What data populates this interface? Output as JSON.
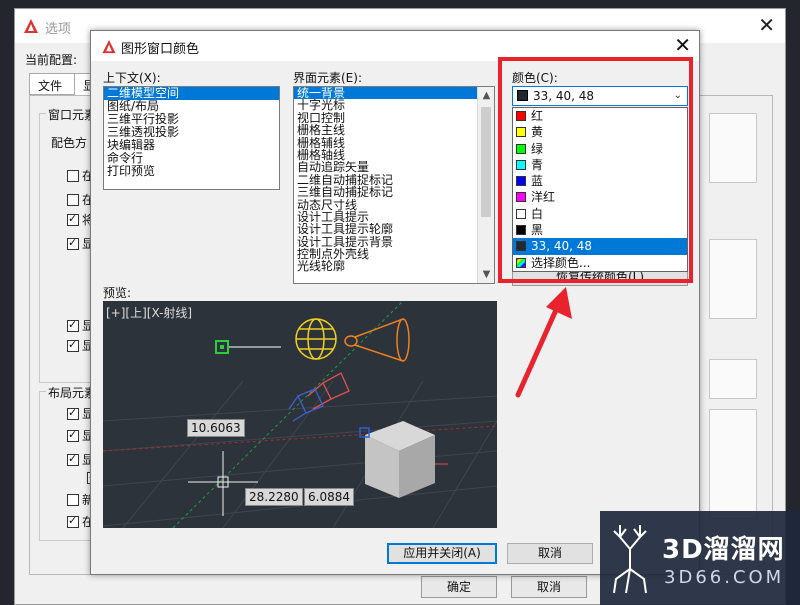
{
  "bg_window": {
    "title": "选项",
    "profile_label": "当前配置:",
    "tabs": [
      "文件",
      "显"
    ],
    "window_elements_label": "窗口元素",
    "color_scheme_label": "配色方",
    "checkbox_items": [
      {
        "label": "在图",
        "checked": false
      },
      {
        "label": "在工",
        "checked": false
      },
      {
        "label": "将块",
        "checked": true
      },
      {
        "label": "显示",
        "checked": true
      },
      {
        "label": "",
        "checked": true
      },
      {
        "label": "",
        "checked": true
      },
      {
        "label": "显示",
        "checked": true
      },
      {
        "label": "显示",
        "checked": true
      }
    ],
    "layout_elements_label": "布局元素",
    "layout_items": [
      {
        "label": "显示",
        "checked": true
      },
      {
        "label": "显示",
        "checked": true
      },
      {
        "label": "显示",
        "checked": true
      },
      {
        "label": "",
        "checked": true
      },
      {
        "label": "新建",
        "checked": false
      },
      {
        "label": "在新",
        "checked": true
      }
    ],
    "ok_label": "确定",
    "cancel_label": "取消"
  },
  "dialog": {
    "title": "图形窗口颜色",
    "context_label": "上下文(X):",
    "context_items": [
      "二维模型空间",
      "图纸/布局",
      "三维平行投影",
      "三维透视投影",
      "块编辑器",
      "命令行",
      "打印预览"
    ],
    "context_selected": 0,
    "element_label": "界面元素(E):",
    "element_items": [
      "统一背景",
      "十字光标",
      "视口控制",
      "栅格主线",
      "栅格辅线",
      "栅格轴线",
      "自动追踪矢量",
      "二维自动捕捉标记",
      "三维自动捕捉标记",
      "动态尺寸线",
      "设计工具提示",
      "设计工具提示轮廓",
      "设计工具提示背景",
      "控制点外壳线",
      "光线轮廓"
    ],
    "element_selected": 0,
    "color_label": "颜色(C):",
    "color_value": "33, 40, 48",
    "color_swatch": "#212830",
    "color_options": [
      {
        "label": "红",
        "swatch": "#ff0000"
      },
      {
        "label": "黄",
        "swatch": "#ffff00"
      },
      {
        "label": "绿",
        "swatch": "#00ff00"
      },
      {
        "label": "青",
        "swatch": "#00ffff"
      },
      {
        "label": "蓝",
        "swatch": "#0000ff"
      },
      {
        "label": "洋红",
        "swatch": "#ff00ff"
      },
      {
        "label": "白",
        "swatch": "#ffffff"
      },
      {
        "label": "黑",
        "swatch": "#000000"
      },
      {
        "label": "33, 40, 48",
        "swatch": "#212830"
      },
      {
        "label": "选择颜色...",
        "swatch": "rainbow"
      }
    ],
    "color_selected": 8,
    "restore_label": "恢复传统颜色(L)",
    "preview_label": "预览:",
    "viewport_label": "[+][上][X-射线]",
    "dim_values": [
      "10.6063",
      "28.2280",
      "6.0884"
    ],
    "apply_close_label": "应用并关闭(A)",
    "cancel_label": "取消"
  },
  "watermark": {
    "name": "3D溜溜网",
    "sub": "3D66.COM"
  },
  "colors": {
    "accent_blue": "#0078d7",
    "highlight_red": "#e8232e",
    "preview_bg": "#2d333b"
  }
}
